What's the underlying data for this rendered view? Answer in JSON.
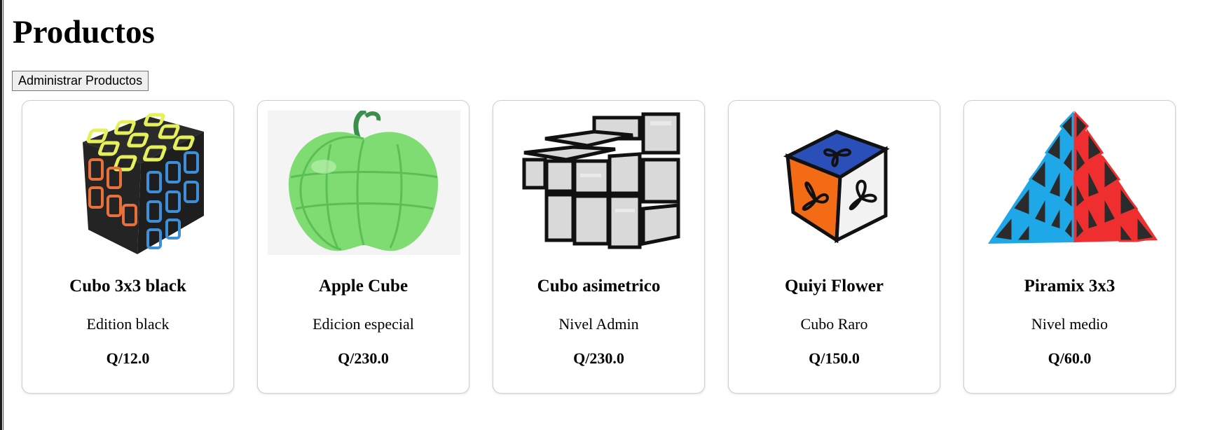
{
  "page": {
    "title": "Productos",
    "admin_button_label": "Administrar Productos"
  },
  "products": [
    {
      "name": "Cubo 3x3 black",
      "description": "Edition black",
      "price": "Q/12.0",
      "image": "black-3x3-cube-image"
    },
    {
      "name": "Apple Cube",
      "description": "Edicion especial",
      "price": "Q/230.0",
      "image": "green-apple-cube-image"
    },
    {
      "name": "Cubo asimetrico",
      "description": "Nivel Admin",
      "price": "Q/230.0",
      "image": "silver-mirror-cube-image"
    },
    {
      "name": "Quiyi Flower",
      "description": "Cubo Raro",
      "price": "Q/150.0",
      "image": "flower-cube-image"
    },
    {
      "name": "Piramix 3x3",
      "description": "Nivel medio",
      "price": "Q/60.0",
      "image": "pyraminx-image"
    }
  ]
}
